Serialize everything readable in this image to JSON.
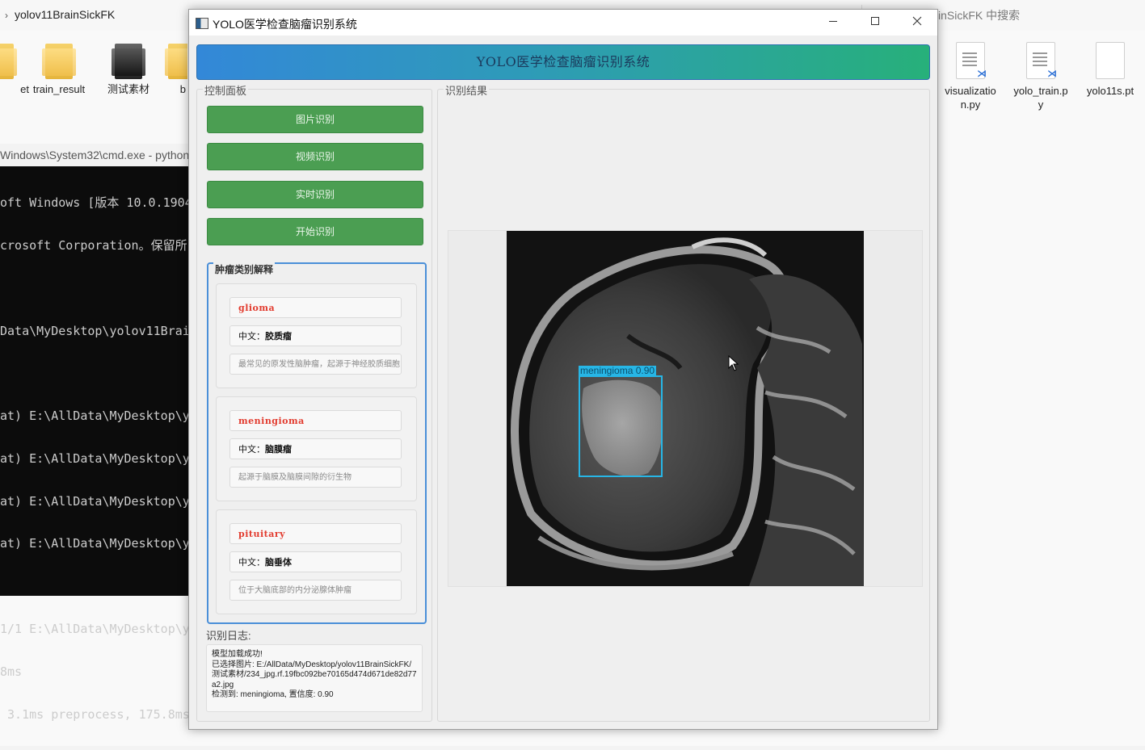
{
  "explorer": {
    "path": "yolov11BrainSickFK",
    "search_placeholder": "inSickFK 中搜索",
    "files": [
      {
        "label": "et",
        "type": "folder"
      },
      {
        "label": "train_result",
        "type": "folder"
      },
      {
        "label": "测试素材",
        "type": "folder-dark"
      },
      {
        "label": "b",
        "type": "folder"
      },
      {
        "label": "visualization.py",
        "type": "python"
      },
      {
        "label": "yolo_train.py",
        "type": "python"
      },
      {
        "label": "yolo11s.pt",
        "type": "file"
      }
    ]
  },
  "terminal": {
    "title": "Windows\\System32\\cmd.exe - python",
    "lines": [
      "oft Windows [版本 10.0.1904",
      "crosoft Corporation。保留所",
      "",
      "Data\\MyDesktop\\yolov11Brain",
      "",
      "at) E:\\AllData\\MyDesktop\\yo",
      "at) E:\\AllData\\MyDesktop\\yo",
      "at) E:\\AllData\\MyDesktop\\yo",
      "at) E:\\AllData\\MyDesktop\\yo",
      "",
      "1/1 E:\\AllData\\MyDesktop\\yo",
      "8ms",
      " 3.1ms preprocess, 175.8ms"
    ]
  },
  "app": {
    "window_title": "YOLO医学检查脑瘤识别系统",
    "header": "YOLO医学检查脑瘤识别系统",
    "control_panel_label": "控制面板",
    "result_panel_label": "识别结果",
    "buttons": {
      "image": "图片识别",
      "video": "视频识别",
      "realtime": "实时识别",
      "start": "开始识别"
    },
    "tumor_group_title": "肿瘤类别解释",
    "tumor_classes": [
      {
        "en": "glioma",
        "cn_prefix": "中文：",
        "cn": "胶质瘤",
        "desc": "最常见的原发性脑肿瘤，起源于神经胶质细胞"
      },
      {
        "en": "meningioma",
        "cn_prefix": "中文：",
        "cn": "脑膜瘤",
        "desc": "起源于脑膜及脑膜间隙的衍生物"
      },
      {
        "en": "pituitary",
        "cn_prefix": "中文：",
        "cn": "脑垂体",
        "desc": "位于大脑底部的内分泌腺体肿瘤"
      }
    ],
    "log_label": "识别日志:",
    "log_lines": [
      "模型加载成功!",
      "已选择图片: E:/AllData/MyDesktop/yolov11BrainSickFK/测试素材/234_jpg.rf.19fbc092be70165d474d671de82d77a2.jpg",
      "检测到: meningioma, 置信度: 0.90"
    ],
    "detection": {
      "label": "meningioma",
      "confidence": "0.90",
      "box_color": "#27b6e6"
    }
  },
  "colors": {
    "button_green": "#4b9e52",
    "header_gradient_start": "#3388d8",
    "header_gradient_end": "#27b07a",
    "tumor_box_border": "#4a8fd8",
    "class_name_red": "#e23b2e"
  }
}
